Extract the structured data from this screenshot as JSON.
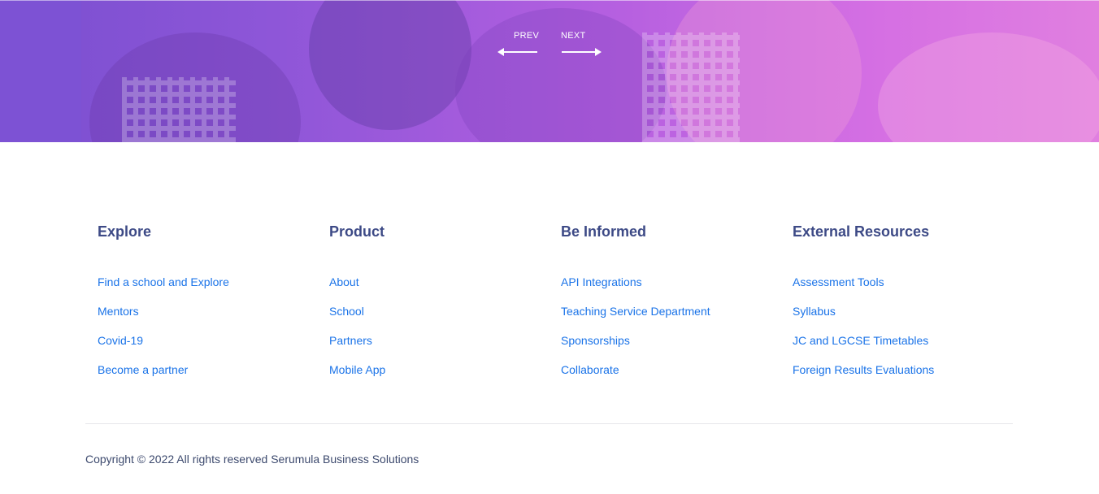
{
  "hero": {
    "prev_label": "PREV",
    "next_label": "NEXT"
  },
  "footer": {
    "columns": [
      {
        "heading": "Explore",
        "links": [
          "Find a school and Explore",
          "Mentors",
          "Covid-19",
          "Become a partner"
        ]
      },
      {
        "heading": "Product",
        "links": [
          "About",
          "School",
          "Partners",
          "Mobile App"
        ]
      },
      {
        "heading": "Be Informed",
        "links": [
          "API Integrations",
          "Teaching Service Department",
          "Sponsorships",
          "Collaborate"
        ]
      },
      {
        "heading": "External Resources",
        "links": [
          "Assessment Tools",
          "Syllabus",
          "JC and LGCSE Timetables",
          "Foreign Results Evaluations"
        ]
      }
    ],
    "copyright": "Copyright © 2022 All rights reserved Serumula Business Solutions"
  },
  "colors": {
    "heading": "#3d4a86",
    "link": "#1a73e8",
    "hero_start": "#7a4fd0",
    "hero_end": "#e07fe0"
  }
}
